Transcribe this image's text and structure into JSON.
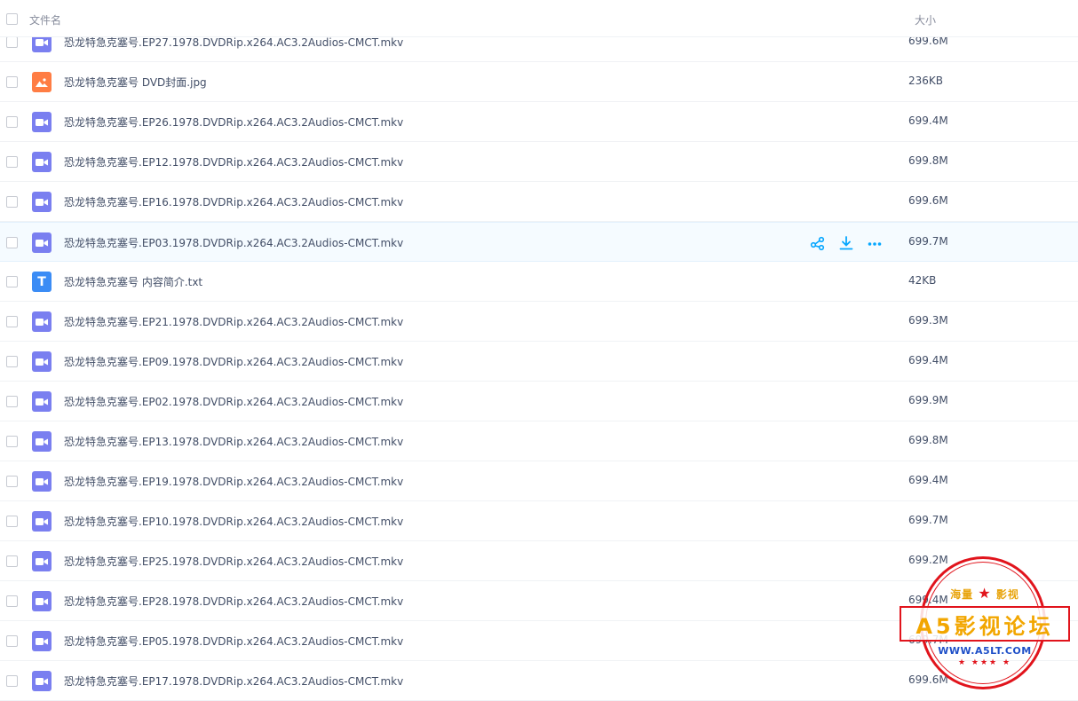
{
  "header": {
    "name_col": "文件名",
    "size_col": "大小"
  },
  "files": [
    {
      "name": "恐龙特急克塞号.EP27.1978.DVDRip.x264.AC3.2Audios-CMCT.mkv",
      "size": "699.6M",
      "type": "video"
    },
    {
      "name": "恐龙特急克塞号 DVD封面.jpg",
      "size": "236KB",
      "type": "image"
    },
    {
      "name": "恐龙特急克塞号.EP26.1978.DVDRip.x264.AC3.2Audios-CMCT.mkv",
      "size": "699.4M",
      "type": "video"
    },
    {
      "name": "恐龙特急克塞号.EP12.1978.DVDRip.x264.AC3.2Audios-CMCT.mkv",
      "size": "699.8M",
      "type": "video"
    },
    {
      "name": "恐龙特急克塞号.EP16.1978.DVDRip.x264.AC3.2Audios-CMCT.mkv",
      "size": "699.6M",
      "type": "video"
    },
    {
      "name": "恐龙特急克塞号.EP03.1978.DVDRip.x264.AC3.2Audios-CMCT.mkv",
      "size": "699.7M",
      "type": "video"
    },
    {
      "name": "恐龙特急克塞号 内容简介.txt",
      "size": "42KB",
      "type": "text"
    },
    {
      "name": "恐龙特急克塞号.EP21.1978.DVDRip.x264.AC3.2Audios-CMCT.mkv",
      "size": "699.3M",
      "type": "video"
    },
    {
      "name": "恐龙特急克塞号.EP09.1978.DVDRip.x264.AC3.2Audios-CMCT.mkv",
      "size": "699.4M",
      "type": "video"
    },
    {
      "name": "恐龙特急克塞号.EP02.1978.DVDRip.x264.AC3.2Audios-CMCT.mkv",
      "size": "699.9M",
      "type": "video"
    },
    {
      "name": "恐龙特急克塞号.EP13.1978.DVDRip.x264.AC3.2Audios-CMCT.mkv",
      "size": "699.8M",
      "type": "video"
    },
    {
      "name": "恐龙特急克塞号.EP19.1978.DVDRip.x264.AC3.2Audios-CMCT.mkv",
      "size": "699.4M",
      "type": "video"
    },
    {
      "name": "恐龙特急克塞号.EP10.1978.DVDRip.x264.AC3.2Audios-CMCT.mkv",
      "size": "699.7M",
      "type": "video"
    },
    {
      "name": "恐龙特急克塞号.EP25.1978.DVDRip.x264.AC3.2Audios-CMCT.mkv",
      "size": "699.2M",
      "type": "video"
    },
    {
      "name": "恐龙特急克塞号.EP28.1978.DVDRip.x264.AC3.2Audios-CMCT.mkv",
      "size": "699.4M",
      "type": "video"
    },
    {
      "name": "恐龙特急克塞号.EP05.1978.DVDRip.x264.AC3.2Audios-CMCT.mkv",
      "size": "699.7M",
      "type": "video"
    },
    {
      "name": "恐龙特急克塞号.EP17.1978.DVDRip.x264.AC3.2Audios-CMCT.mkv",
      "size": "699.6M",
      "type": "video"
    }
  ],
  "hovered_row": 5,
  "row_actions": [
    "share-icon",
    "download-icon",
    "more-icon"
  ],
  "watermark": {
    "top_left": "海量",
    "top_right": "影视",
    "title": "A5影视论坛",
    "url": "WWW.A5LT.COM"
  },
  "colors": {
    "accent": "#06a7ff",
    "video_icon": "#7a7ff0",
    "image_icon": "#ff7d44",
    "text_icon": "#3b8cf5",
    "stamp_red": "#e1141c"
  }
}
